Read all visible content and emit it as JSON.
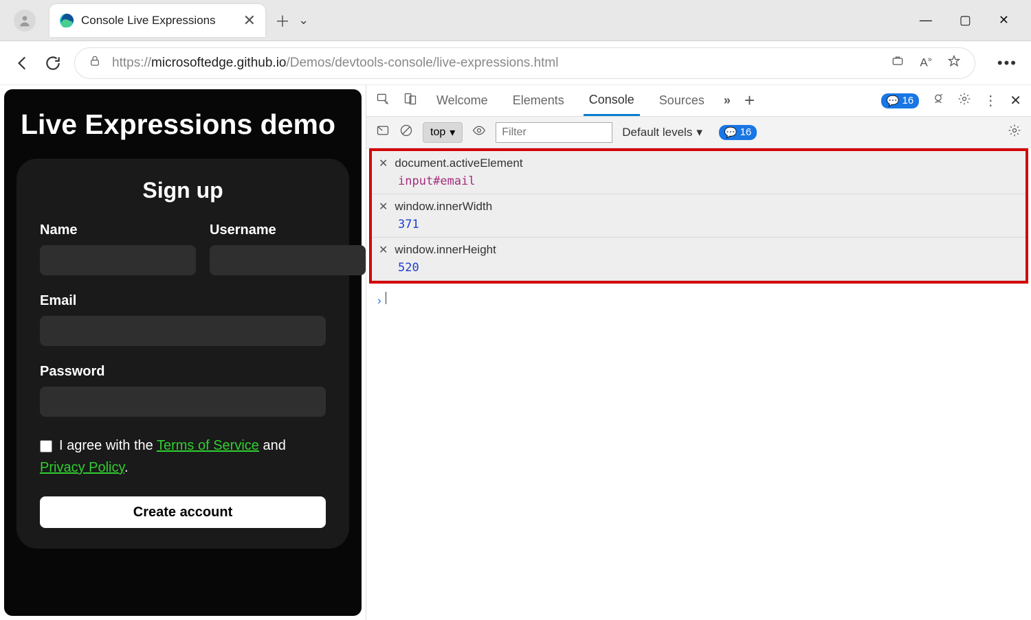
{
  "tab": {
    "title": "Console Live Expressions"
  },
  "url": {
    "prefix": "https://",
    "host": "microsoftedge.github.io",
    "path": "/Demos/devtools-console/live-expressions.html"
  },
  "page": {
    "title": "Live Expressions demo",
    "formTitle": "Sign up",
    "labels": {
      "name": "Name",
      "username": "Username",
      "email": "Email",
      "password": "Password"
    },
    "agree": {
      "pre": "I agree with the ",
      "tos": "Terms of Service",
      "mid": " and ",
      "pp": "Privacy Policy",
      "suf": "."
    },
    "button": "Create account"
  },
  "devtools": {
    "tabs": {
      "welcome": "Welcome",
      "elements": "Elements",
      "console": "Console",
      "sources": "Sources"
    },
    "issueCount": "16",
    "toolbar": {
      "context": "top",
      "filterPlaceholder": "Filter",
      "levels": "Default levels",
      "issues": "16"
    },
    "live": [
      {
        "expr": "document.activeElement",
        "value": "input#email",
        "valueClass": "val-purple"
      },
      {
        "expr": "window.innerWidth",
        "value": "371",
        "valueClass": "val-blue"
      },
      {
        "expr": "window.innerHeight",
        "value": "520",
        "valueClass": "val-blue"
      }
    ]
  }
}
